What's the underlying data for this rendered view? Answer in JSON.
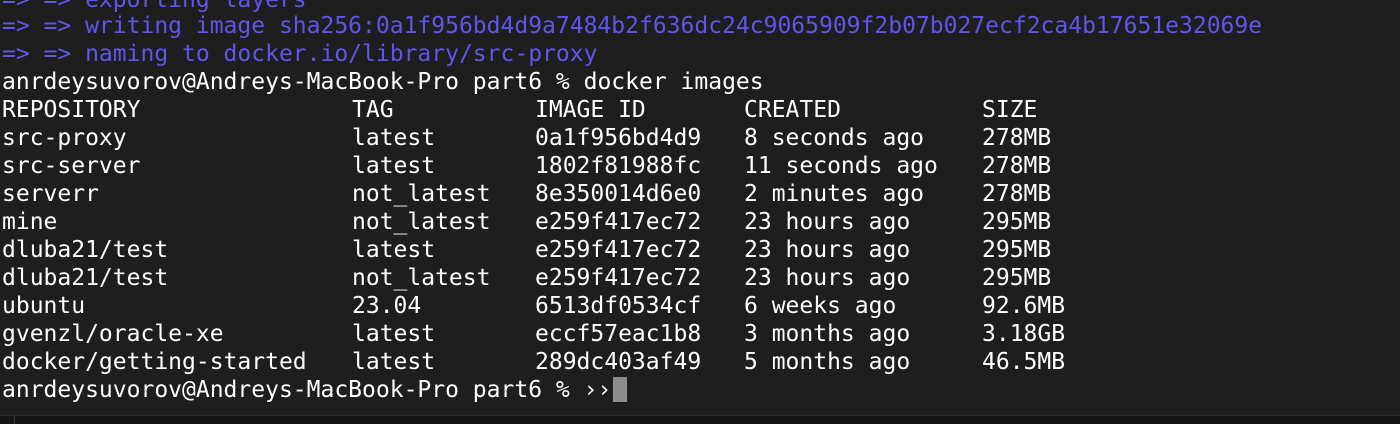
{
  "build_output": [
    "=> => exporting layers",
    "=> => writing image sha256:0a1f956bd4d9a7484b2f636dc24c9065909f2b07b027ecf2ca4b17651e32069e",
    "=> => naming to docker.io/library/src-proxy"
  ],
  "command_line": {
    "prompt": "anrdeysuvorov@Andreys-MacBook-Pro part6 % ",
    "command": "docker images"
  },
  "images_table": {
    "headers": {
      "repository": "REPOSITORY",
      "tag": "TAG",
      "image_id": "IMAGE ID",
      "created": "CREATED",
      "size": "SIZE"
    },
    "rows": [
      {
        "repository": "src-proxy",
        "tag": "latest",
        "image_id": "0a1f956bd4d9",
        "created": "8 seconds ago",
        "size": "278MB"
      },
      {
        "repository": "src-server",
        "tag": "latest",
        "image_id": "1802f81988fc",
        "created": "11 seconds ago",
        "size": "278MB"
      },
      {
        "repository": "serverr",
        "tag": "not_latest",
        "image_id": "8e350014d6e0",
        "created": "2 minutes ago",
        "size": "278MB"
      },
      {
        "repository": "mine",
        "tag": "not_latest",
        "image_id": "e259f417ec72",
        "created": "23 hours ago",
        "size": "295MB"
      },
      {
        "repository": "dluba21/test",
        "tag": "latest",
        "image_id": "e259f417ec72",
        "created": "23 hours ago",
        "size": "295MB"
      },
      {
        "repository": "dluba21/test",
        "tag": "not_latest",
        "image_id": "e259f417ec72",
        "created": "23 hours ago",
        "size": "295MB"
      },
      {
        "repository": "ubuntu",
        "tag": "23.04",
        "image_id": "6513df0534cf",
        "created": "6 weeks ago",
        "size": "92.6MB"
      },
      {
        "repository": "gvenzl/oracle-xe",
        "tag": "latest",
        "image_id": "eccf57eac1b8",
        "created": "3 months ago",
        "size": "3.18GB"
      },
      {
        "repository": "docker/getting-started",
        "tag": "latest",
        "image_id": "289dc403af49",
        "created": "5 months ago",
        "size": "46.5MB"
      }
    ]
  },
  "current_prompt": {
    "prompt": "anrdeysuvorov@Andreys-MacBook-Pro part6 % ",
    "input": "››"
  },
  "colors": {
    "background": "#1e1e1e",
    "foreground": "#ffffff",
    "build_output": "#5f55e9",
    "cursor": "#8c8c8c"
  }
}
